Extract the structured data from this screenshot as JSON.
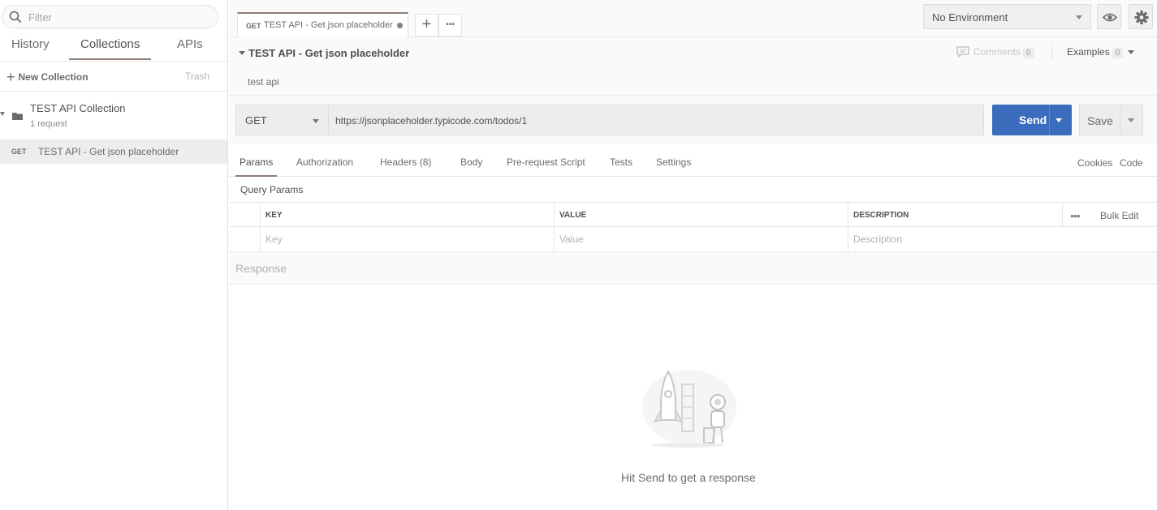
{
  "sidebar": {
    "filter_placeholder": "Filter",
    "tabs": [
      "History",
      "Collections",
      "APIs"
    ],
    "new_collection": "New Collection",
    "trash": "Trash",
    "collection": {
      "name": "TEST API Collection",
      "count": "1 request",
      "request": {
        "method": "GET",
        "name": "TEST API - Get json placeholder"
      }
    }
  },
  "topbar": {
    "tab": {
      "method": "GET",
      "title": "TEST API - Get json placeholder"
    },
    "add_tab": "+",
    "more_tabs": "•••",
    "environment": "No Environment"
  },
  "request": {
    "title": "TEST API - Get json placeholder",
    "description": "test api",
    "comments_label": "Comments",
    "comments_count": "0",
    "examples_label": "Examples",
    "examples_count": "0",
    "method": "GET",
    "url": "https://jsonplaceholder.typicode.com/todos/1",
    "send": "Send",
    "save": "Save"
  },
  "request_tabs": {
    "items": [
      "Params",
      "Authorization",
      "Headers (8)",
      "Body",
      "Pre-request Script",
      "Tests",
      "Settings"
    ],
    "cookies": "Cookies",
    "code": "Code"
  },
  "params": {
    "title": "Query Params",
    "headers": [
      "KEY",
      "VALUE",
      "DESCRIPTION"
    ],
    "placeholders": [
      "Key",
      "Value",
      "Description"
    ],
    "more": "•••",
    "bulk_edit": "Bulk Edit"
  },
  "response": {
    "title": "Response",
    "hint": "Hit Send to get a response"
  },
  "colors": {
    "accent": "#8f7c75",
    "send_button": "#3a6dbd"
  }
}
